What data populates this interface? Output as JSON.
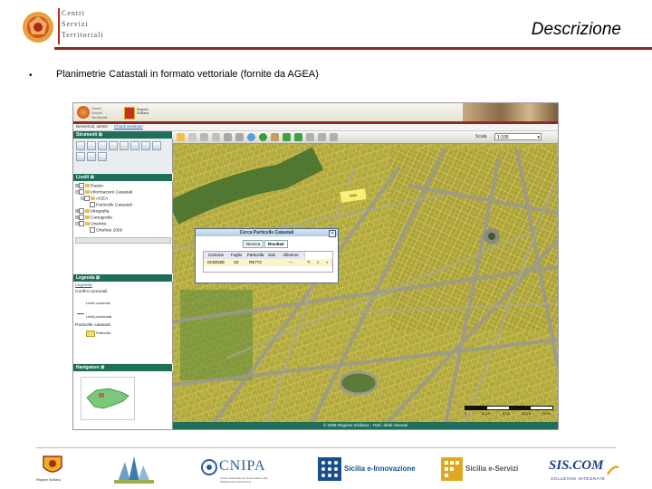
{
  "header": {
    "logo_lines": [
      "Centri",
      "Servizi",
      "Territoriali"
    ],
    "title": "Descrizione"
  },
  "bullet": {
    "symbol": "•",
    "text": "Planimetrie Catastali in formato vettoriale (fornite da AGEA)"
  },
  "app": {
    "logo_left_lines": [
      "Centri",
      "Servizi",
      "Territoriali"
    ],
    "logo_right_lines": [
      "Regione",
      "Siciliana"
    ],
    "subbar_text": "Benvenuti, utente",
    "subbar_link": "Chiudi sessione",
    "panels": {
      "tools": "Strumenti",
      "layers": "Livelli",
      "legend": "Legenda",
      "navigator": "Navigatore"
    },
    "layers_tree": [
      "Raster",
      "Informazioni Catastali",
      "AGEA",
      "Particelle Catastali",
      "Idrografia",
      "Cartografia",
      "Ortofoto",
      "Ortofoto 2000"
    ],
    "legend_items": [
      "Legenda",
      "Confini comunali",
      "Limiti comunali",
      "Limiti provinciali",
      "Particelle catastali",
      "Particelle"
    ],
    "scale_label": "Scala",
    "scale_value": "1:100",
    "footer": "© 2009 Regione Siciliana - Tutti i diritti riservati",
    "scalebar_labels": [
      "0",
      "18,75",
      "37,5",
      "56,25",
      "75 m"
    ],
    "note_tag": "nota"
  },
  "dialog": {
    "title": "Cerca Particelle Catastali",
    "tabs": [
      "Ricerca",
      "Risultati"
    ],
    "columns": [
      "Comune",
      "Foglio",
      "Particella",
      "Sub",
      "Allineme"
    ],
    "row": [
      "SCIENZE",
      "63",
      "RE772",
      "",
      "---"
    ]
  },
  "bottom_logos": [
    "Regione Siciliana",
    "CNIPA",
    "Centro Nazionale per l'Informatica nella Pubblica Amministrazione",
    "Sicilia e-Innovazione",
    "Sicilia e-Servizi",
    "SIS.COM",
    "SOLUZIONI INTEGRATE"
  ],
  "colors": {
    "accent_rule": "#8b2b24",
    "panel_header": "#1f6e5a",
    "map_base": "#9fa34a"
  }
}
